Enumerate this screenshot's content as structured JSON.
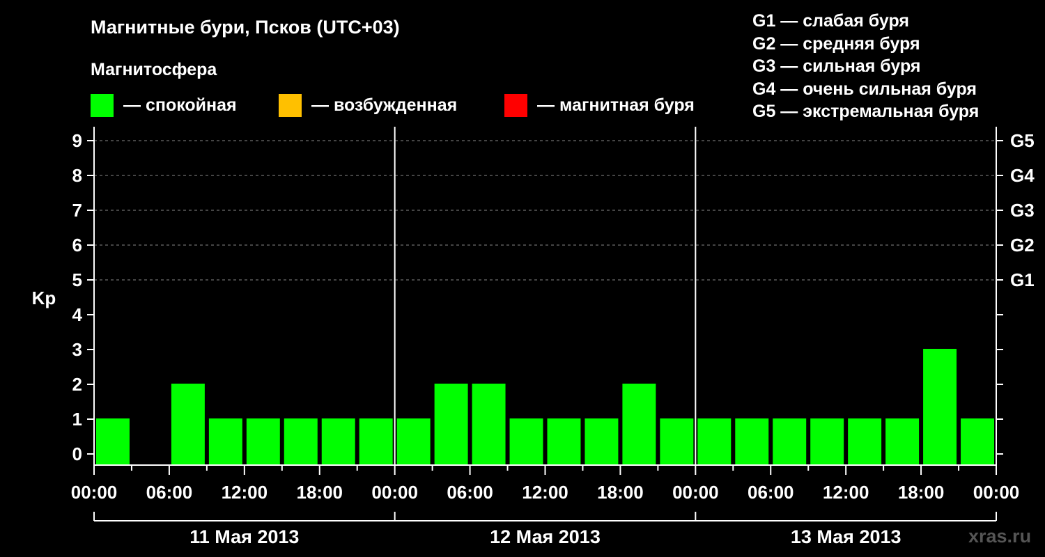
{
  "header": {
    "title": "Магнитные бури, Псков (UTC+03)",
    "subtitle": "Магнитосфера"
  },
  "legend": {
    "items": [
      {
        "label": "— спокойная",
        "color": "#00ff00"
      },
      {
        "label": "— возбужденная",
        "color": "#ffc000"
      },
      {
        "label": "— магнитная буря",
        "color": "#ff0000"
      }
    ]
  },
  "storm_scale": [
    "G1 — слабая буря",
    "G2 — средняя буря",
    "G3 — сильная буря",
    "G4 — очень сильная буря",
    "G5 — экстремальная буря"
  ],
  "watermark": "xras.ru",
  "chart_data": {
    "type": "bar",
    "ylabel": "Kp",
    "ylim": [
      0,
      9
    ],
    "y_ticks": [
      "0",
      "1",
      "2",
      "3",
      "4",
      "5",
      "6",
      "7",
      "8",
      "9"
    ],
    "right_axis_labels": [
      {
        "kp": 5,
        "label": "G1"
      },
      {
        "kp": 6,
        "label": "G2"
      },
      {
        "kp": 7,
        "label": "G3"
      },
      {
        "kp": 8,
        "label": "G4"
      },
      {
        "kp": 9,
        "label": "G5"
      }
    ],
    "grid_levels": [
      5,
      6,
      7,
      8,
      9
    ],
    "bar_color": "#00ff00",
    "hours_per_bar": 3,
    "x_tick_labels": [
      "00:00",
      "06:00",
      "12:00",
      "18:00",
      "00:00",
      "06:00",
      "12:00",
      "18:00",
      "00:00",
      "06:00",
      "12:00",
      "18:00",
      "00:00"
    ],
    "days": [
      "11 Мая 2013",
      "12 Мая 2013",
      "13 Мая 2013"
    ],
    "values": [
      1,
      0,
      2,
      1,
      1,
      1,
      1,
      1,
      1,
      2,
      2,
      1,
      1,
      1,
      2,
      1,
      1,
      1,
      1,
      1,
      1,
      1,
      3,
      1
    ]
  }
}
